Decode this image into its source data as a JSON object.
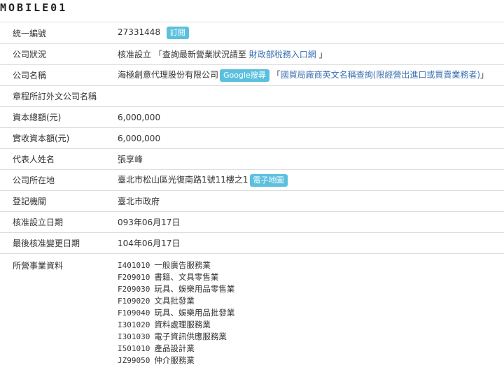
{
  "logo": {
    "text": "MOBILE01"
  },
  "rows": [
    {
      "label": "統一編號",
      "value": "27331448",
      "badge": "訂閱"
    },
    {
      "label": "公司狀況",
      "value": "核准設立",
      "open_quote": "「",
      "pre": "查詢最新營業狀況請至",
      "link": "財政部稅務入口網",
      "close_quote": "」"
    },
    {
      "label": "公司名稱",
      "value": "海極創意代理股份有限公司",
      "badge": "Google搜尋",
      "open_quote": "「",
      "link": "國貿局廠商英文名稱查詢(限經營出進口或買賣業務者)",
      "close_quote": "」"
    },
    {
      "label": "章程所訂外文公司名稱",
      "value": ""
    },
    {
      "label": "資本總額(元)",
      "value": "6,000,000"
    },
    {
      "label": "實收資本額(元)",
      "value": "6,000,000"
    },
    {
      "label": "代表人姓名",
      "value": "張享峰"
    },
    {
      "label": "公司所在地",
      "value": "臺北市松山區光復南路1號11樓之1",
      "badge": "電子地圖"
    },
    {
      "label": "登記機關",
      "value": "臺北市政府"
    },
    {
      "label": "核准設立日期",
      "value": "093年06月17日"
    },
    {
      "label": "最後核准變更日期",
      "value": "104年06月17日"
    }
  ],
  "business": {
    "label": "所營事業資料",
    "items": [
      {
        "code": "I401010",
        "name": "一般廣告服務業"
      },
      {
        "code": "F209010",
        "name": "書籍、文具零售業"
      },
      {
        "code": "F209030",
        "name": "玩具、娛樂用品零售業"
      },
      {
        "code": "F109020",
        "name": "文具批發業"
      },
      {
        "code": "F109040",
        "name": "玩具、娛樂用品批發業"
      },
      {
        "code": "I301020",
        "name": "資料處理服務業"
      },
      {
        "code": "I301030",
        "name": "電子資訊供應服務業"
      },
      {
        "code": "I501010",
        "name": "產品設計業"
      },
      {
        "code": "JZ99050",
        "name": "仲介服務業"
      }
    ]
  },
  "colors": {
    "badge": "#5bc0de",
    "link": "#3a6fb0",
    "border": "#dddddd"
  }
}
